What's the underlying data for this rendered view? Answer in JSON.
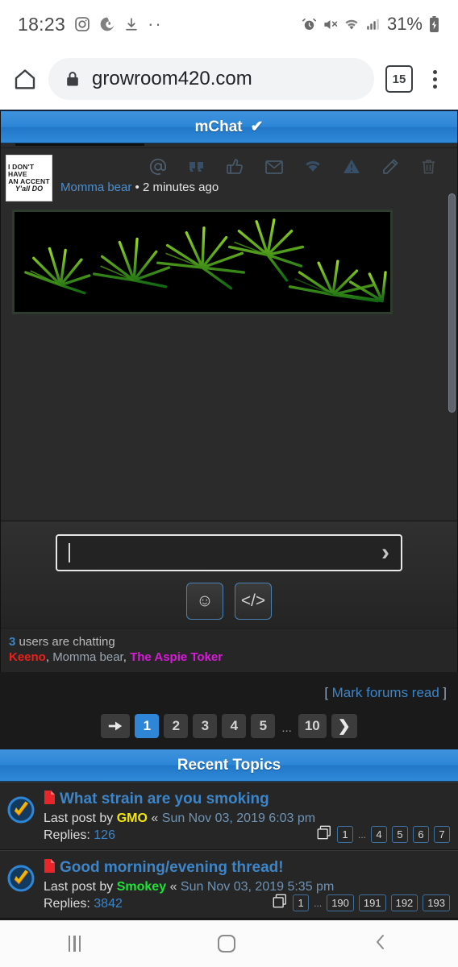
{
  "status_bar": {
    "time": "18:23",
    "left_icons": [
      "instagram-icon",
      "spiral-icon",
      "download-icon",
      "more-dots-icon"
    ],
    "right_icons": [
      "alarm-icon",
      "mute-icon",
      "wifi-icon",
      "signal-icon"
    ],
    "battery_percent": "31%",
    "battery_icon": "battery-charging-icon"
  },
  "browser": {
    "home_icon": "home-icon",
    "lock_icon": "lock-icon",
    "url": "growroom420.com",
    "tab_count": "15",
    "menu_icon": "kebab-menu-icon"
  },
  "mchat": {
    "title": "mChat",
    "verified_glyph": "✔",
    "message": {
      "avatar_lines": [
        "I DON'T HAVE",
        "AN ACCENT",
        "Y'all DO"
      ],
      "username": "Momma bear",
      "separator": "•",
      "timestamp": "2 minutes ago",
      "tools": [
        "mention-icon",
        "quote-icon",
        "thumbs-up-icon",
        "mail-icon",
        "rss-icon",
        "report-icon",
        "edit-icon",
        "delete-icon"
      ],
      "attachment_alt": "cannabis-plants-image"
    },
    "input": {
      "value": "",
      "placeholder": "",
      "send_glyph": "›"
    },
    "buttons": [
      {
        "name": "emoji-button",
        "glyph": "☺"
      },
      {
        "name": "bbcode-button",
        "glyph": "</>"
      }
    ],
    "chatters": {
      "count": "3",
      "label": "users are chatting",
      "users": [
        {
          "name": "Keeno",
          "color": "#e8211b"
        },
        {
          "name": "Momma bear",
          "color": "#9aa6b2"
        },
        {
          "name": "The Aspie Toker",
          "color": "#d91ad9"
        }
      ]
    }
  },
  "forum": {
    "mark_read": {
      "open_bracket": "[",
      "label": "Mark forums read",
      "close_bracket": "]"
    },
    "pagination": {
      "jump_icon": "jump-to-page-icon",
      "pages": [
        "1",
        "2",
        "3",
        "4",
        "5"
      ],
      "ellipsis": "...",
      "last": "10",
      "next_glyph": "❯",
      "active": "1"
    },
    "recent_topics_title": "Recent Topics",
    "topics": [
      {
        "icon": "unread-topic-icon",
        "doc_icon": "document-icon",
        "title": "What strain are you smoking",
        "last_post_label": "Last post by",
        "author": "GMO",
        "author_color": "#f2e60b",
        "quote_glyph": "«",
        "date": "Sun Nov 03, 2019 6:03 pm",
        "replies_label": "Replies:",
        "replies": "126",
        "pages_icon": "pages-icon",
        "pages": [
          "1"
        ],
        "ellipsis": "...",
        "tail_pages": [
          "4",
          "5",
          "6",
          "7"
        ]
      },
      {
        "icon": "unread-topic-icon",
        "doc_icon": "document-icon",
        "title": "Good morning/evening thread!",
        "last_post_label": "Last post by",
        "author": "Smokey",
        "author_color": "#22e03a",
        "quote_glyph": "«",
        "date": "Sun Nov 03, 2019 5:35 pm",
        "replies_label": "Replies:",
        "replies": "3842",
        "pages_icon": "pages-icon",
        "pages": [
          "1"
        ],
        "ellipsis": "...",
        "tail_pages": [
          "190",
          "191",
          "192",
          "193"
        ]
      }
    ]
  },
  "nav_bar": {
    "recents": "recents-icon",
    "home": "home-icon",
    "back": "back-icon",
    "back_glyph": "‹"
  },
  "colors": {
    "accent_blue": "#2f86d6",
    "link_blue": "#3c85c8",
    "panel_bg": "#2b2b2b",
    "page_bg": "#1a1a1a"
  }
}
